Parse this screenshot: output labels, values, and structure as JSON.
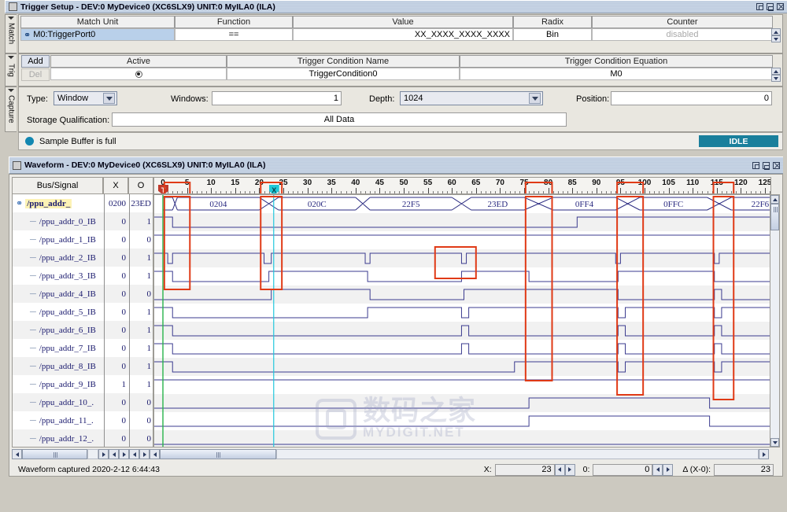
{
  "trigger_setup": {
    "title": "Trigger Setup - DEV:0 MyDevice0 (XC6SLX9) UNIT:0 MyILA0 (ILA)",
    "side_tabs": [
      "Match",
      "Trig",
      "Capture"
    ],
    "match_table": {
      "headers": [
        "Match Unit",
        "Function",
        "Value",
        "Radix",
        "Counter"
      ],
      "rows": [
        {
          "match_unit": "M0:TriggerPort0",
          "function": "==",
          "value": "XX_XXXX_XXXX_XXXX",
          "radix": "Bin",
          "counter": "disabled"
        }
      ]
    },
    "trig_table": {
      "add_label": "Add",
      "del_label": "Del",
      "headers": [
        "Active",
        "Trigger Condition Name",
        "Trigger Condition Equation"
      ],
      "rows": [
        {
          "active": true,
          "name": "TriggerCondition0",
          "equation": "M0"
        }
      ]
    },
    "capture": {
      "type_label": "Type:",
      "type_value": "Window",
      "windows_label": "Windows:",
      "windows_value": "1",
      "depth_label": "Depth:",
      "depth_value": "1024",
      "position_label": "Position:",
      "position_value": "0",
      "storage_label": "Storage Qualification:",
      "storage_value": "All Data"
    },
    "status": {
      "text": "Sample Buffer is full",
      "state": "IDLE",
      "state_color": "#1a7f9c",
      "led_color": "#1287b1"
    }
  },
  "waveform": {
    "title": "Waveform - DEV:0 MyDevice0 (XC6SLX9) UNIT:0 MyILA0 (ILA)",
    "columns": [
      "Bus/Signal",
      "X",
      "O"
    ],
    "ruler_ticks": [
      0,
      5,
      10,
      15,
      20,
      25,
      30,
      35,
      40,
      45,
      50,
      55,
      60,
      65,
      70,
      75,
      80,
      85,
      90,
      95,
      100,
      105,
      110,
      115,
      120,
      125
    ],
    "trigger_marker": "T",
    "cursor_marker": "X",
    "bus_segments": [
      {
        "label": "",
        "start": 0,
        "end": 2
      },
      {
        "label": "0204",
        "start": 3,
        "end": 20
      },
      {
        "label": "020C",
        "start": 24,
        "end": 40
      },
      {
        "label": "22F5",
        "start": 43,
        "end": 60
      },
      {
        "label": "23ED",
        "start": 64,
        "end": 75
      },
      {
        "label": "0FF4",
        "start": 81,
        "end": 94
      },
      {
        "label": "0FFC",
        "start": 99,
        "end": 113
      },
      {
        "label": "22F6",
        "start": 118,
        "end": 130
      }
    ],
    "signals": [
      {
        "name": "/ppu_addr_",
        "x": "0200",
        "o": "23ED",
        "is_bus": true,
        "indent": 0
      },
      {
        "name": "/ppu_addr_0_IB",
        "x": "0",
        "o": "1",
        "is_bus": false,
        "indent": 1
      },
      {
        "name": "/ppu_addr_1_IB",
        "x": "0",
        "o": "0",
        "is_bus": false,
        "indent": 1
      },
      {
        "name": "/ppu_addr_2_IB",
        "x": "0",
        "o": "1",
        "is_bus": false,
        "indent": 1
      },
      {
        "name": "/ppu_addr_3_IB",
        "x": "0",
        "o": "1",
        "is_bus": false,
        "indent": 1
      },
      {
        "name": "/ppu_addr_4_IB",
        "x": "0",
        "o": "0",
        "is_bus": false,
        "indent": 1
      },
      {
        "name": "/ppu_addr_5_IB",
        "x": "0",
        "o": "1",
        "is_bus": false,
        "indent": 1
      },
      {
        "name": "/ppu_addr_6_IB",
        "x": "0",
        "o": "1",
        "is_bus": false,
        "indent": 1
      },
      {
        "name": "/ppu_addr_7_IB",
        "x": "0",
        "o": "1",
        "is_bus": false,
        "indent": 1
      },
      {
        "name": "/ppu_addr_8_IB",
        "x": "0",
        "o": "1",
        "is_bus": false,
        "indent": 1
      },
      {
        "name": "/ppu_addr_9_IB",
        "x": "1",
        "o": "1",
        "is_bus": false,
        "indent": 1
      },
      {
        "name": "/ppu_addr_10_.",
        "x": "0",
        "o": "0",
        "is_bus": false,
        "indent": 1
      },
      {
        "name": "/ppu_addr_11_.",
        "x": "0",
        "o": "0",
        "is_bus": false,
        "indent": 1
      },
      {
        "name": "/ppu_addr_12_.",
        "x": "0",
        "o": "0",
        "is_bus": false,
        "indent": 1
      }
    ],
    "status_bar": {
      "capture_text": "Waveform captured 2020-2-12 6:44:43",
      "x_label": "X:",
      "x_value": "23",
      "o_label": "0:",
      "o_value": "0",
      "delta_label": "Δ (X-0):",
      "delta_value": "23"
    },
    "annotation_color": "#e03a16"
  },
  "watermark": {
    "text_cn": "数码之家",
    "text_en": "MYDIGIT.NET"
  }
}
